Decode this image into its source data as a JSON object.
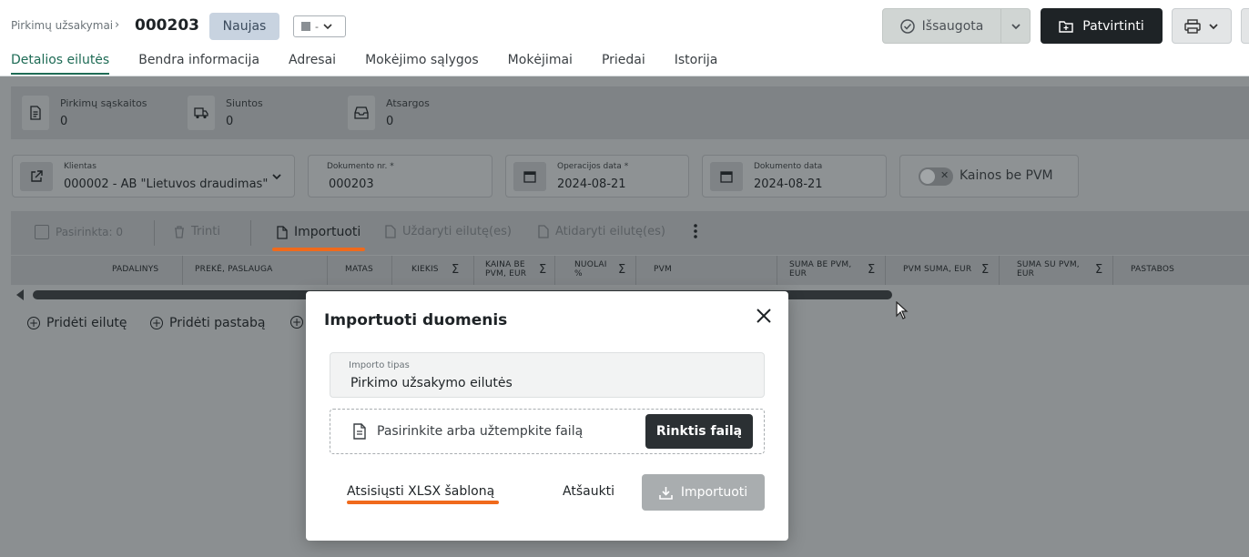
{
  "header": {
    "breadcrumb": "Pirkimų užsakymai",
    "doc_number": "000203",
    "status_badge": "Naujas",
    "color_select": "-",
    "saved_label": "Išsaugota",
    "confirm_label": "Patvirtinti"
  },
  "tabs": [
    {
      "label": "Detalios eilutės",
      "active": true
    },
    {
      "label": "Bendra informacija"
    },
    {
      "label": "Adresai"
    },
    {
      "label": "Mokėjimo sąlygos"
    },
    {
      "label": "Mokėjimai"
    },
    {
      "label": "Priedai"
    },
    {
      "label": "Istorija"
    }
  ],
  "summary": [
    {
      "label": "Pirkimų sąskaitos",
      "value": "0"
    },
    {
      "label": "Siuntos",
      "value": "0"
    },
    {
      "label": "Atsargos",
      "value": "0"
    }
  ],
  "fields": {
    "client_label": "Klientas",
    "client_value": "000002 - AB \"Lietuvos draudimas\"",
    "docno_label": "Dokumento nr. *",
    "docno_value": "000203",
    "opdate_label": "Operacijos data *",
    "opdate_value": "2024-08-21",
    "docdate_label": "Dokumento data",
    "docdate_value": "2024-08-21",
    "toggle_label": "Kainos be PVM"
  },
  "toolbar": {
    "selected": "Pasirinkta: 0",
    "delete": "Trinti",
    "import": "Importuoti",
    "close_lines": "Uždaryti eilutę(es)",
    "open_lines": "Atidaryti eilutę(es)"
  },
  "columns": {
    "c1": "PADALINYS",
    "c2": "PREKĖ, PASLAUGA",
    "c3": "MATAS",
    "c4": "KIEKIS",
    "c5a": "KAINA BE",
    "c5b": "PVM, EUR",
    "c6a": "NUOLAI",
    "c6b": "%",
    "c7": "PVM",
    "c8a": "SUMA BE PVM,",
    "c8b": "EUR",
    "c9": "PVM SUMA, EUR",
    "c10a": "SUMA SU PVM,",
    "c10b": "EUR",
    "c11": "PASTABOS",
    "sigma": "Σ"
  },
  "add_actions": {
    "add_line": "Pridėti eilutę",
    "add_note": "Pridėti pastabą"
  },
  "modal": {
    "title": "Importuoti duomenis",
    "type_label": "Importo tipas",
    "type_value": "Pirkimo užsakymo eilutės",
    "drop_text": "Pasirinkite arba užtempkite failą",
    "choose_file": "Rinktis failą",
    "download_template": "Atsisiųsti XLSX šabloną",
    "cancel": "Atšaukti",
    "import": "Importuoti"
  },
  "colors": {
    "accent_underline": "#f06a1c",
    "active_tab": "#1e6b55",
    "dark_button": "#1e2326",
    "disabled_button": "#a9adaf"
  }
}
